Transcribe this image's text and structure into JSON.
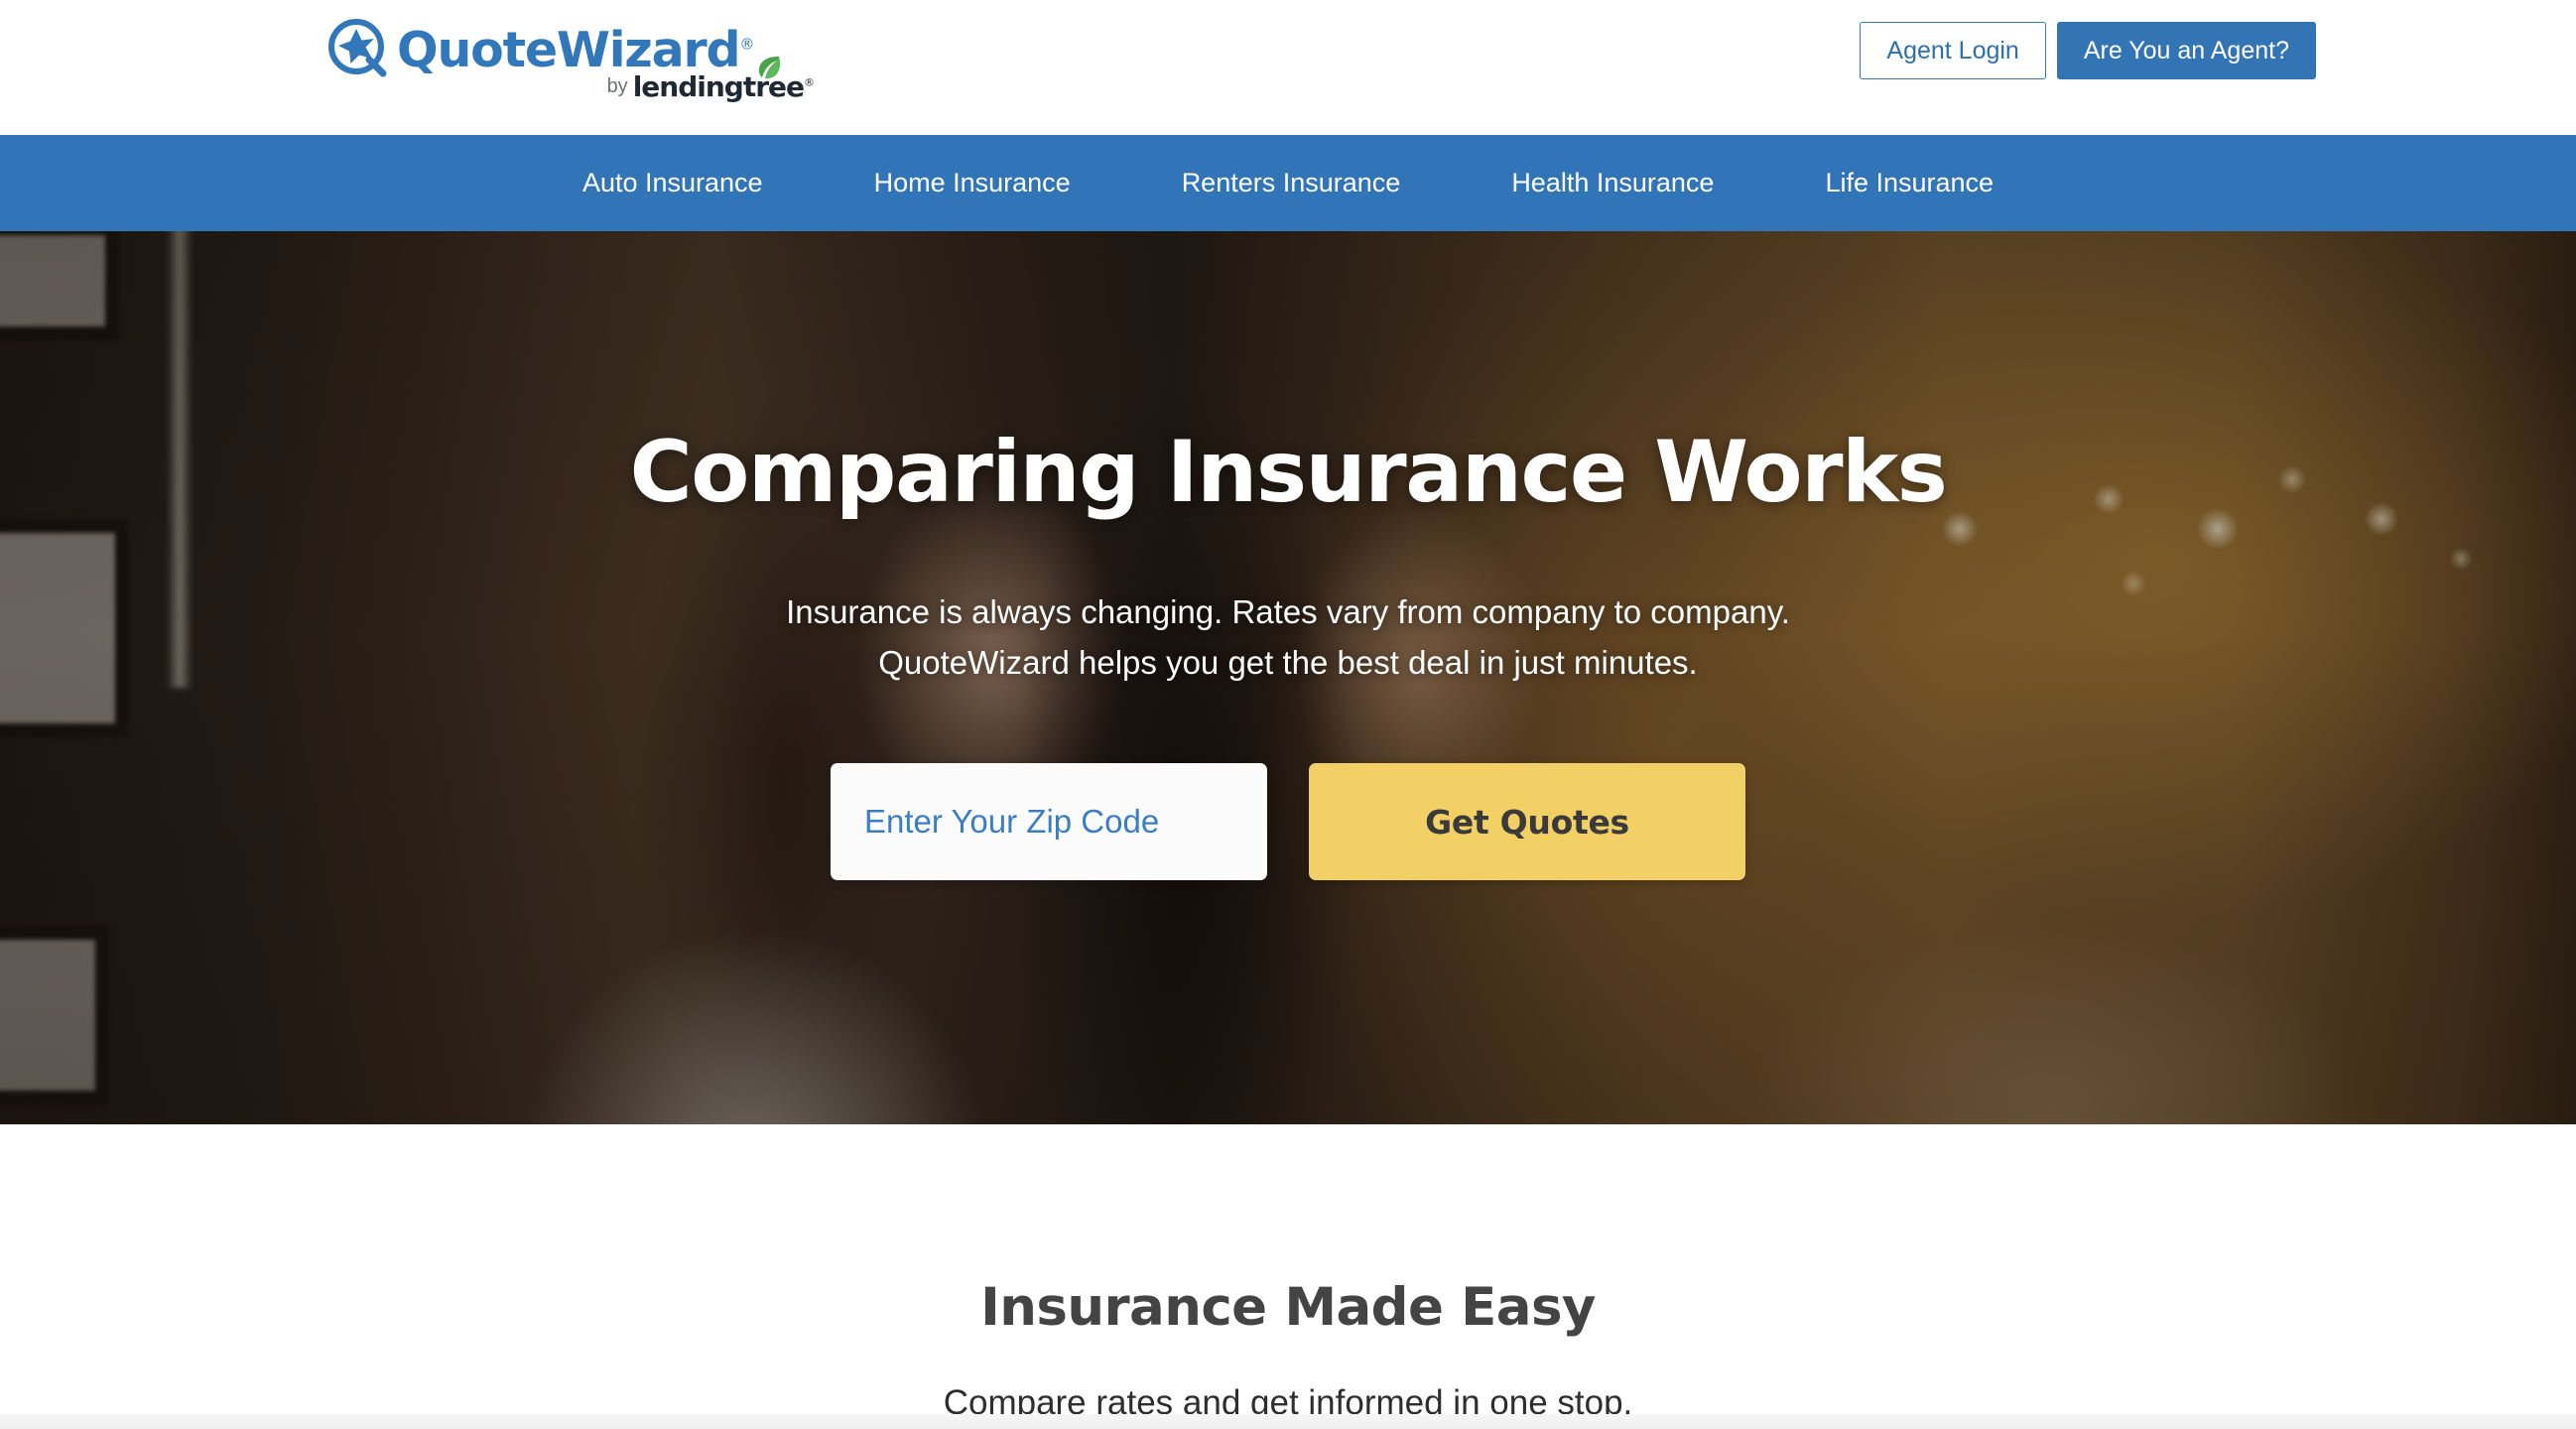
{
  "header": {
    "logo": {
      "brand": "QuoteWizard",
      "registered_mark": "®",
      "by_label": "by",
      "parent_brand": "lendingtree",
      "parent_registered_mark": "®",
      "mark_icon": "quotewizard-star-q-icon",
      "leaf_icon": "lendingtree-leaf-icon"
    },
    "agent_login_label": "Agent Login",
    "are_you_an_agent_label": "Are You an Agent?"
  },
  "nav": {
    "items": [
      {
        "label": "Auto Insurance"
      },
      {
        "label": "Home Insurance"
      },
      {
        "label": "Renters Insurance"
      },
      {
        "label": "Health Insurance"
      },
      {
        "label": "Life Insurance"
      }
    ]
  },
  "hero": {
    "title": "Comparing Insurance Works",
    "subtitle_line1": "Insurance is always changing. Rates vary from company to company.",
    "subtitle_line2": "QuoteWizard helps you get the best deal in just minutes.",
    "zip_placeholder": "Enter Your Zip Code",
    "zip_value": "",
    "cta_label": "Get Quotes"
  },
  "section_easy": {
    "title": "Insurance Made Easy",
    "subtitle": "Compare rates and get informed in one stop."
  },
  "colors": {
    "brand_blue": "#3277b9",
    "nav_blue": "#3175b8",
    "button_blue": "#3274b4",
    "cta_yellow": "#f2d065",
    "link_blue": "#2f6fae",
    "heading_gray": "#444444",
    "leaf_green": "#4caf50"
  }
}
